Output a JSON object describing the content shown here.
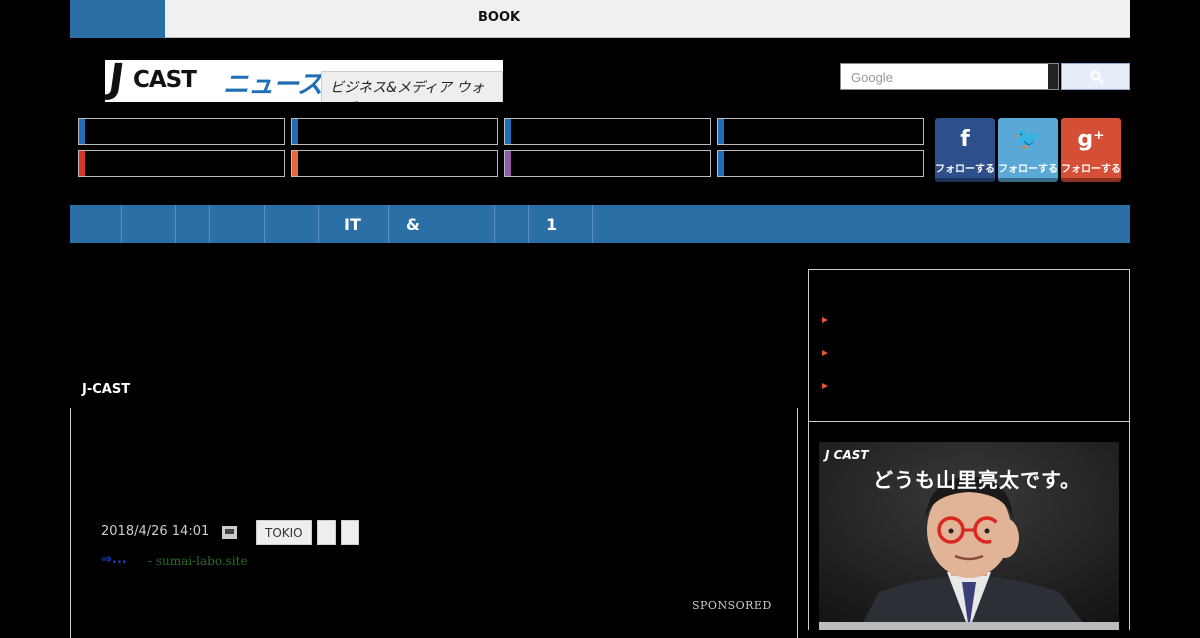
{
  "top_tabs": {
    "book_label": "BOOK"
  },
  "logo": {
    "j": "J",
    "cast": "CAST",
    "news": "ニュース",
    "tagline": "ビジネス&メディア ウォッチ"
  },
  "search": {
    "placeholder": "Google"
  },
  "social": {
    "facebook": {
      "label": "フォローする",
      "glyph": "f",
      "color": "#2d4f8a"
    },
    "twitter": {
      "label": "フォローする",
      "glyph": "🐦",
      "color": "#5aa8d6"
    },
    "googleplus": {
      "label": "フォローする",
      "glyph": "g⁺",
      "color": "#d44f36"
    }
  },
  "category_colors": [
    "#1e6fb5",
    "#1e6fb5",
    "#1e6fb5",
    "#1e6fb5",
    "#d7352c",
    "#e8673c",
    "#8e5ea2",
    "#1e6fb5"
  ],
  "nav": {
    "items": [
      "IT",
      "&",
      "1"
    ]
  },
  "main": {
    "source_label": "J-CAST"
  },
  "article": {
    "date": "2018/4/26 14:01",
    "tags": [
      "TOKIO",
      "",
      ""
    ],
    "pr_link": "⇒...",
    "pr_source": "- sumai-labo.site",
    "sponsored": "SPONSORED"
  },
  "side_ad": {
    "brand": "J CAST",
    "headline": "どうも山里亮太です。"
  },
  "colors": {
    "nav_blue": "#2a70a6",
    "bullet": "#e8543c"
  }
}
